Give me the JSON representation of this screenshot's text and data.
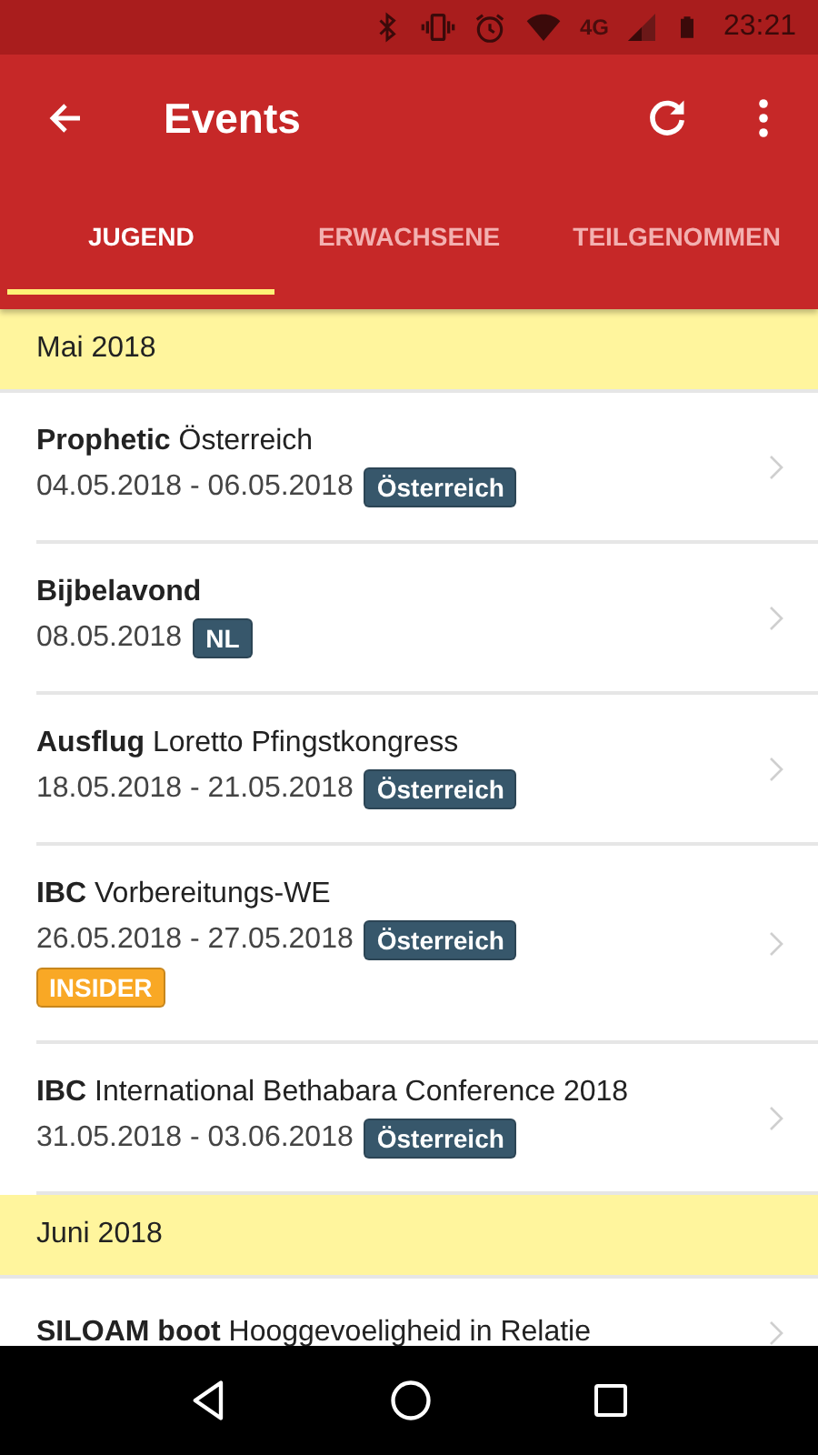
{
  "status_bar": {
    "network": "4G",
    "time": "23:21"
  },
  "toolbar": {
    "title": "Events"
  },
  "tabs": [
    {
      "label": "JUGEND",
      "selected": true
    },
    {
      "label": "ERWACHSENE",
      "selected": false
    },
    {
      "label": "TEILGENOMMEN",
      "selected": false
    }
  ],
  "sections": [
    {
      "header": "Mai 2018",
      "events": [
        {
          "title": "**Prophetic** Österreich",
          "dates": "04.05.2018 - 06.05.2018",
          "tags": [
            {
              "label": "Österreich",
              "color": "#37576b"
            }
          ]
        },
        {
          "title": "**Bijbelavond**",
          "dates": "08.05.2018",
          "tags": [
            {
              "label": "NL",
              "color": "#37576b"
            }
          ]
        },
        {
          "title": "**Ausflug** Loretto Pfingstkongress",
          "dates": "18.05.2018 - 21.05.2018",
          "tags": [
            {
              "label": "Österreich",
              "color": "#37576b"
            }
          ]
        },
        {
          "title": "**IBC** Vorbereitungs-WE",
          "dates": "26.05.2018 - 27.05.2018",
          "tags": [
            {
              "label": "Österreich",
              "color": "#37576b"
            },
            {
              "label": "INSIDER",
              "color": "#f9a825"
            }
          ]
        },
        {
          "title": "**IBC** International Bethabara Conference 2018",
          "dates": "31.05.2018 - 03.06.2018",
          "tags": [
            {
              "label": "Österreich",
              "color": "#37576b"
            }
          ]
        }
      ]
    },
    {
      "header": "Juni 2018",
      "events": [
        {
          "title": "**SILOAM boot** Hooggevoeligheid in Relatie"
        }
      ]
    }
  ]
}
